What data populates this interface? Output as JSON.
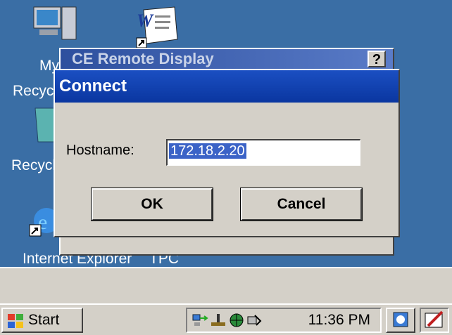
{
  "desktop": {
    "icons": [
      {
        "label": "My Computer"
      },
      {
        "label": "Recycle Bin"
      },
      {
        "label": "Internet Explorer"
      },
      {
        "label": "TPC"
      }
    ]
  },
  "background_window": {
    "title": "CE Remote Display",
    "help_label": "?"
  },
  "dialog": {
    "title": "Connect",
    "hostname_label": "Hostname:",
    "hostname_value": "172.18.2.20",
    "ok_label": "OK",
    "cancel_label": "Cancel"
  },
  "taskbar": {
    "start_label": "Start",
    "clock": "11:36 PM"
  },
  "colors": {
    "desktop": "#3a6ea5",
    "titlebar": "#0a36a0",
    "selection": "#3b63c7"
  }
}
